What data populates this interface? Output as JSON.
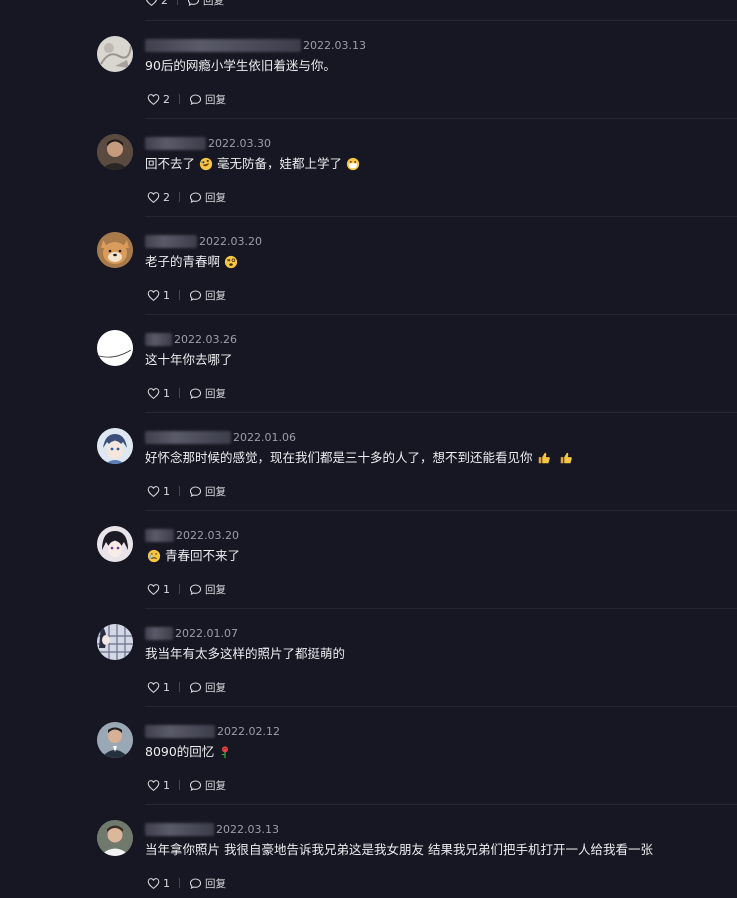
{
  "top_partial": {
    "like_count": "2",
    "reply_label": "回复"
  },
  "comments": [
    {
      "date": "2022.03.13",
      "text": "90后的网瘾小学生依旧着迷与你。",
      "like_count": "2",
      "reply_label": "回复",
      "avatar_icon": "avatar-light-sketch"
    },
    {
      "date": "2022.03.30",
      "text_parts": [
        "回不去了",
        "毫无防备，娃都上学了"
      ],
      "emojis": [
        "rolling-laugh-emoji",
        "masked-face-emoji"
      ],
      "like_count": "2",
      "reply_label": "回复",
      "avatar_icon": "avatar-man-portrait"
    },
    {
      "date": "2022.03.20",
      "text_parts": [
        "老子的青春啊"
      ],
      "emojis": [
        "dizzy-face-emoji"
      ],
      "like_count": "1",
      "reply_label": "回复",
      "avatar_icon": "avatar-shiba-dog"
    },
    {
      "date": "2022.03.26",
      "text": "这十年你去哪了",
      "like_count": "1",
      "reply_label": "回复",
      "avatar_icon": "avatar-white-circle"
    },
    {
      "date": "2022.01.06",
      "text_parts": [
        "好怀念那时候的感觉，现在我们都是三十多的人了，想不到还能看见你"
      ],
      "emojis": [
        "thumbs-up-emoji",
        "thumbs-up-emoji"
      ],
      "like_count": "1",
      "reply_label": "回复",
      "avatar_icon": "avatar-anime-blue"
    },
    {
      "date": "2022.03.20",
      "text_parts": [
        "青春回不来了"
      ],
      "emojis": [
        "crying-face-emoji"
      ],
      "like_count": "1",
      "reply_label": "回复",
      "avatar_icon": "avatar-anime-dark"
    },
    {
      "date": "2022.01.07",
      "text": "我当年有太多这样的照片了都挺萌的",
      "like_count": "1",
      "reply_label": "回复",
      "avatar_icon": "avatar-anime-grid"
    },
    {
      "date": "2022.02.12",
      "text_parts": [
        "8090的回忆"
      ],
      "emojis": [
        "rose-emoji"
      ],
      "like_count": "1",
      "reply_label": "回复",
      "avatar_icon": "avatar-man-suit"
    },
    {
      "date": "2022.03.13",
      "text": "当年拿你照片 我很自豪地告诉我兄弟这是我女朋友 结果我兄弟们把手机打开一人给我看一张",
      "like_count": "1",
      "reply_label": "回复",
      "avatar_icon": "avatar-man-casual"
    }
  ],
  "colors": {
    "background": "#161722",
    "text": "#ececf0",
    "muted": "#9c9caa",
    "divider": "#242532"
  }
}
